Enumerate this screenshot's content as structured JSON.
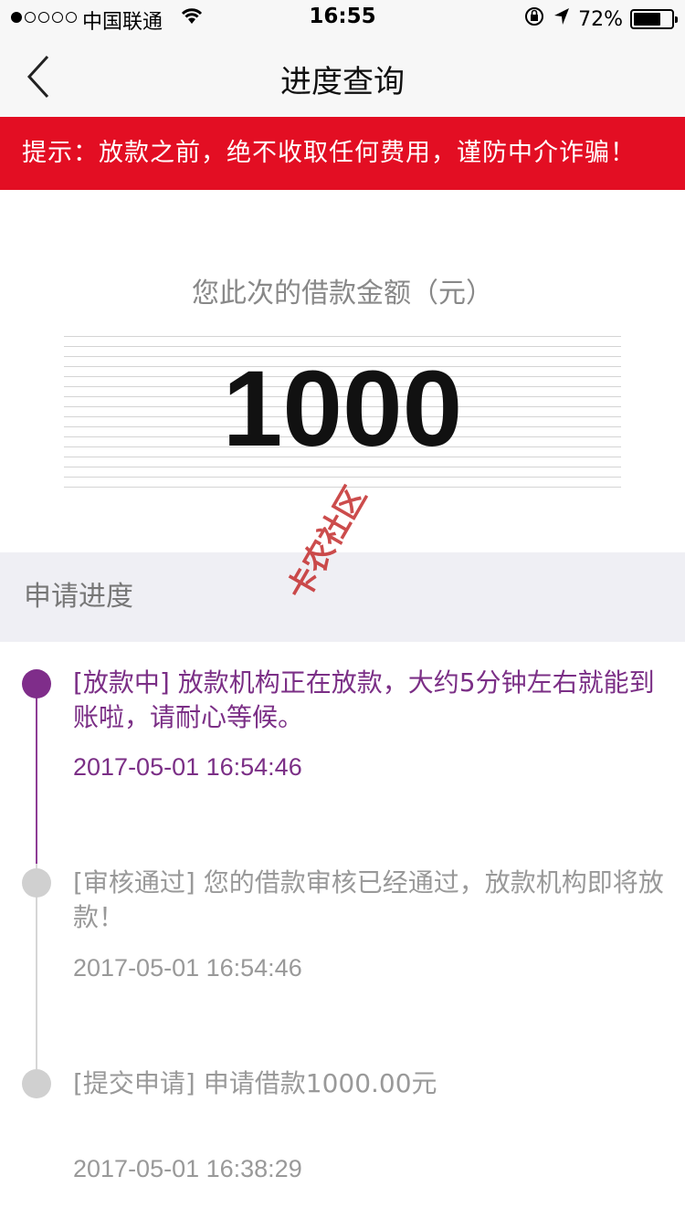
{
  "status_bar": {
    "carrier": "中国联通",
    "time": "16:55",
    "battery_percent": "72%",
    "battery_level": 0.72
  },
  "nav": {
    "title": "进度查询",
    "back_icon": "chevron-left-icon"
  },
  "banner": {
    "text": "提示：放款之前，绝不收取任何费用，谨防中介诈骗！"
  },
  "amount": {
    "label": "您此次的借款金额（元）",
    "value": "1000"
  },
  "progress": {
    "header": "申请进度",
    "steps": [
      {
        "text": "[放款中] 放款机构正在放款，大约5分钟左右就能到账啦，请耐心等候。",
        "time": "2017-05-01 16:54:46",
        "status": "active"
      },
      {
        "text": "[审核通过] 您的借款审核已经通过，放款机构即将放款！",
        "time": "2017-05-01 16:54:46",
        "status": "done"
      },
      {
        "text": "[提交申请] 申请借款1000.00元",
        "time": "2017-05-01 16:38:29",
        "status": "done"
      }
    ]
  },
  "watermark": {
    "text": "卡农社区"
  },
  "colors": {
    "banner": "#e30e23",
    "active": "#7b2f86",
    "inactive": "#d0d0d0"
  }
}
